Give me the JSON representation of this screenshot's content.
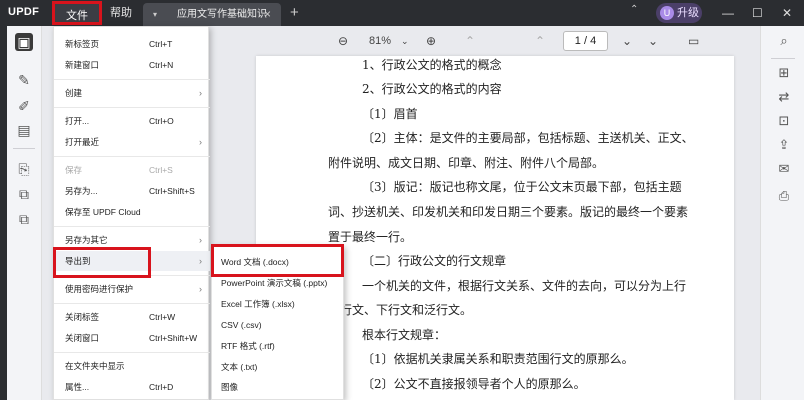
{
  "titlebar": {
    "logo": "UPDF",
    "menu_file": "文件",
    "menu_help": "帮助",
    "tab_title": "应用文写作基础知识",
    "tab_dropdown": "▾",
    "tab_close": "×",
    "new_tab": "+",
    "chevron": "⌃",
    "upgrade_avatar": "U",
    "upgrade_label": "升级",
    "min": "—",
    "max": "☐",
    "close": "✕"
  },
  "toolbar": {
    "zoom_out": "⊖",
    "zoom_level": "81%",
    "zoom_dropdown": "⌄",
    "zoom_in": "⊕",
    "first_page": "⌃",
    "prev_page": "⌃",
    "page_indicator": "1 / 4",
    "next_page": "⌄",
    "last_page": "⌄",
    "comment": "▭"
  },
  "left_tools": {
    "reader": "▣",
    "highlight": "✎",
    "edit": "✐",
    "form": "▤",
    "organize": "⎘",
    "compress": "⧉",
    "layers": "⧉"
  },
  "right_tools": {
    "search": "⌕",
    "ocr": "⊞",
    "convert": "⇄",
    "protect": "⊡",
    "share": "⇪",
    "email": "✉",
    "save": "⎙"
  },
  "document": {
    "lines": [
      "1、行政公文的格式的概念",
      "2、行政公文的格式的内容",
      "〔1〕眉首",
      "〔2〕主体：是文件的主要局部，包括标题、主送机关、正文、",
      "附件说明、成文日期、印章、附注、附件八个局部。",
      "〔3〕版记：版记也称文尾，位于公文末页最下部，包括主题",
      "词、抄送机关、印发机关和印发日期三个要素。版记的最终一个要素",
      "置于最终一行。",
      "〔二〕行政公文的行文规章",
      "一个机关的文件，根据行文关系、文件的去向，可以分为上行",
      "平行文、下行文和泛行文。",
      "根本行文规章：",
      "〔1〕依据机关隶属关系和职责范围行文的原那么。",
      "〔2〕公文不直接报领导者个人的原那么。"
    ]
  },
  "file_menu": {
    "items": [
      {
        "label": "新标签页",
        "shortcut": "Ctrl+T"
      },
      {
        "label": "新建窗口",
        "shortcut": "Ctrl+N"
      },
      {
        "label": "创建",
        "arrow": "›"
      },
      {
        "label": "打开...",
        "shortcut": "Ctrl+O"
      },
      {
        "label": "打开最近",
        "arrow": "›"
      },
      {
        "label": "保存",
        "shortcut": "Ctrl+S"
      },
      {
        "label": "另存为...",
        "shortcut": "Ctrl+Shift+S"
      },
      {
        "label": "保存至 UPDF Cloud"
      },
      {
        "label": "另存为其它",
        "arrow": "›"
      },
      {
        "label": "导出到",
        "arrow": "›"
      },
      {
        "label": "使用密码进行保护",
        "arrow": "›"
      },
      {
        "label": "关闭标签",
        "shortcut": "Ctrl+W"
      },
      {
        "label": "关闭窗口",
        "shortcut": "Ctrl+Shift+W"
      },
      {
        "label": "在文件夹中显示"
      },
      {
        "label": "属性...",
        "shortcut": "Ctrl+D"
      }
    ]
  },
  "export_menu": {
    "items": [
      "Word 文档 (.docx)",
      "PowerPoint 演示文稿 (.pptx)",
      "Excel 工作簿 (.xlsx)",
      "CSV (.csv)",
      "RTF 格式 (.rtf)",
      "文本 (.txt)",
      "图像"
    ]
  },
  "colors": {
    "highlight_box": "#d8131c",
    "titlebar_bg": "#2b2d31",
    "upgrade_bg": "#4b3f68"
  }
}
